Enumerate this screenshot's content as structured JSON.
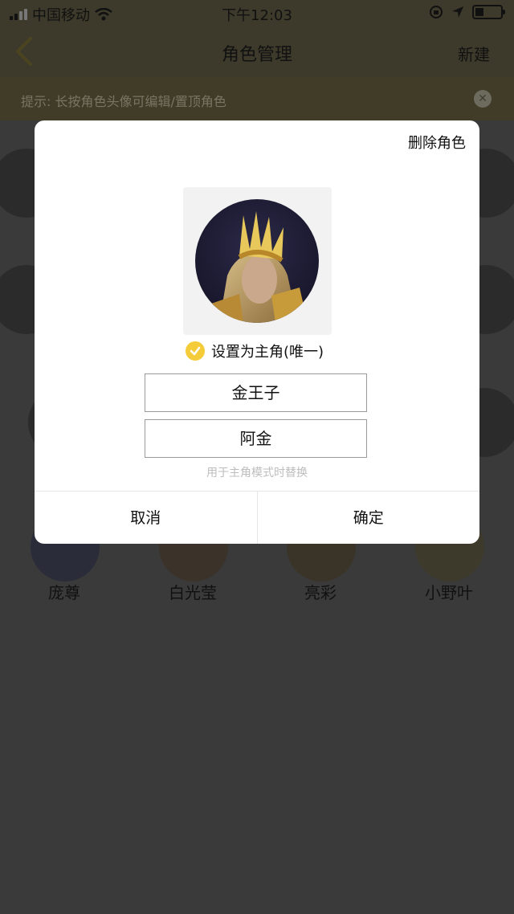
{
  "status_bar": {
    "carrier": "中国移动",
    "time": "下午12:03"
  },
  "nav": {
    "title": "角色管理",
    "new_label": "新建"
  },
  "hint": {
    "text": "提示: 长按角色头像可编辑/置顶角色"
  },
  "background_characters": [
    {
      "name": "庞尊"
    },
    {
      "name": "白光莹"
    },
    {
      "name": "亮彩"
    },
    {
      "name": "小野叶"
    }
  ],
  "dialog": {
    "delete_label": "删除角色",
    "main_role_label": "设置为主角(唯一)",
    "main_role_checked": true,
    "name_value": "金王子",
    "alias_value": "阿金",
    "helper_text": "用于主角模式时替换",
    "cancel_label": "取消",
    "confirm_label": "确定"
  },
  "colors": {
    "accent": "#f4cc3a",
    "overlay": "#3a3a3a"
  }
}
